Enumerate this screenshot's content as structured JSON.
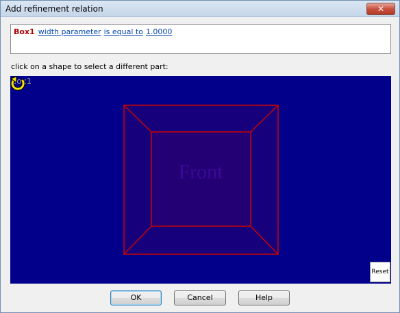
{
  "window": {
    "title": "Add refinement relation",
    "close_glyph": "✕"
  },
  "relation": {
    "part": "Box1",
    "parameter": "width parameter",
    "operator": "is equal to",
    "value": "1.0000"
  },
  "instruction": "click on a shape to select a different part:",
  "viewport": {
    "part_label": "Box1",
    "face_label": "Front",
    "reset_label": "Reset",
    "rotate_icon": "rotate-arrow-icon",
    "colors": {
      "background": "#02008b",
      "edges": "#cc0000",
      "face": "#2a0070",
      "label": "#3a0a9a"
    }
  },
  "buttons": {
    "ok": "OK",
    "cancel": "Cancel",
    "help": "Help"
  }
}
